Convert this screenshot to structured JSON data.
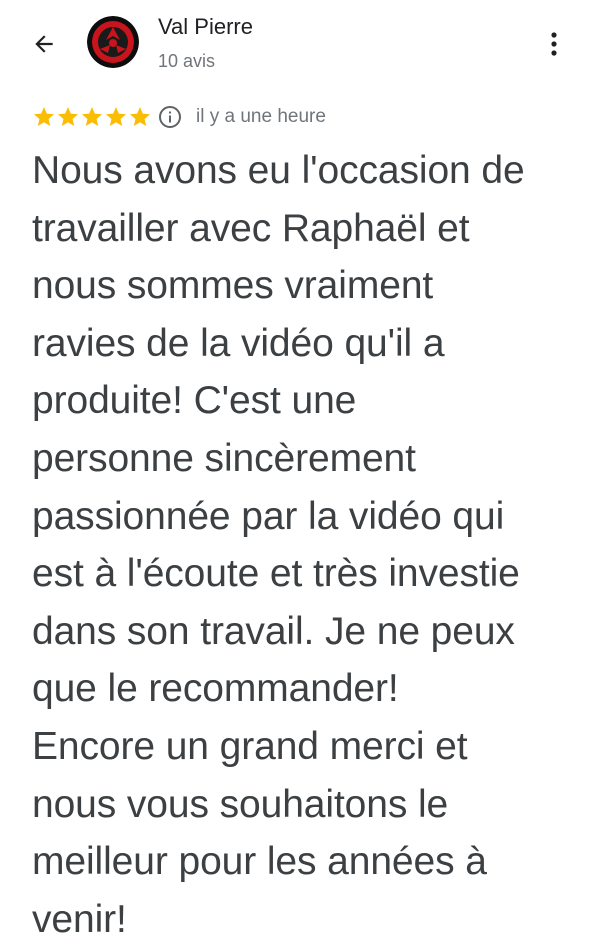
{
  "header": {
    "reviewer_name": "Val Pierre",
    "review_count": "10 avis",
    "back_icon": "arrow-back-icon",
    "more_icon": "more-vert-icon"
  },
  "review": {
    "rating": 5,
    "rating_max": 5,
    "star_color": "#fbbc04",
    "time_ago": "il y a une heure",
    "lines": [
      "Nous avons eu l'occasion de",
      "travailler avec Raphaël et",
      "nous sommes vraiment",
      "ravies de la vidéo qu'il a",
      "produite! C'est une",
      "personne sincèrement",
      "passionnée par la vidéo qui",
      "est à l'écoute et très investie",
      "dans son travail. Je ne peux",
      "que le recommander!",
      "Encore un grand merci et",
      "nous vous souhaitons le",
      "meilleur pour les années à",
      "venir!"
    ]
  }
}
